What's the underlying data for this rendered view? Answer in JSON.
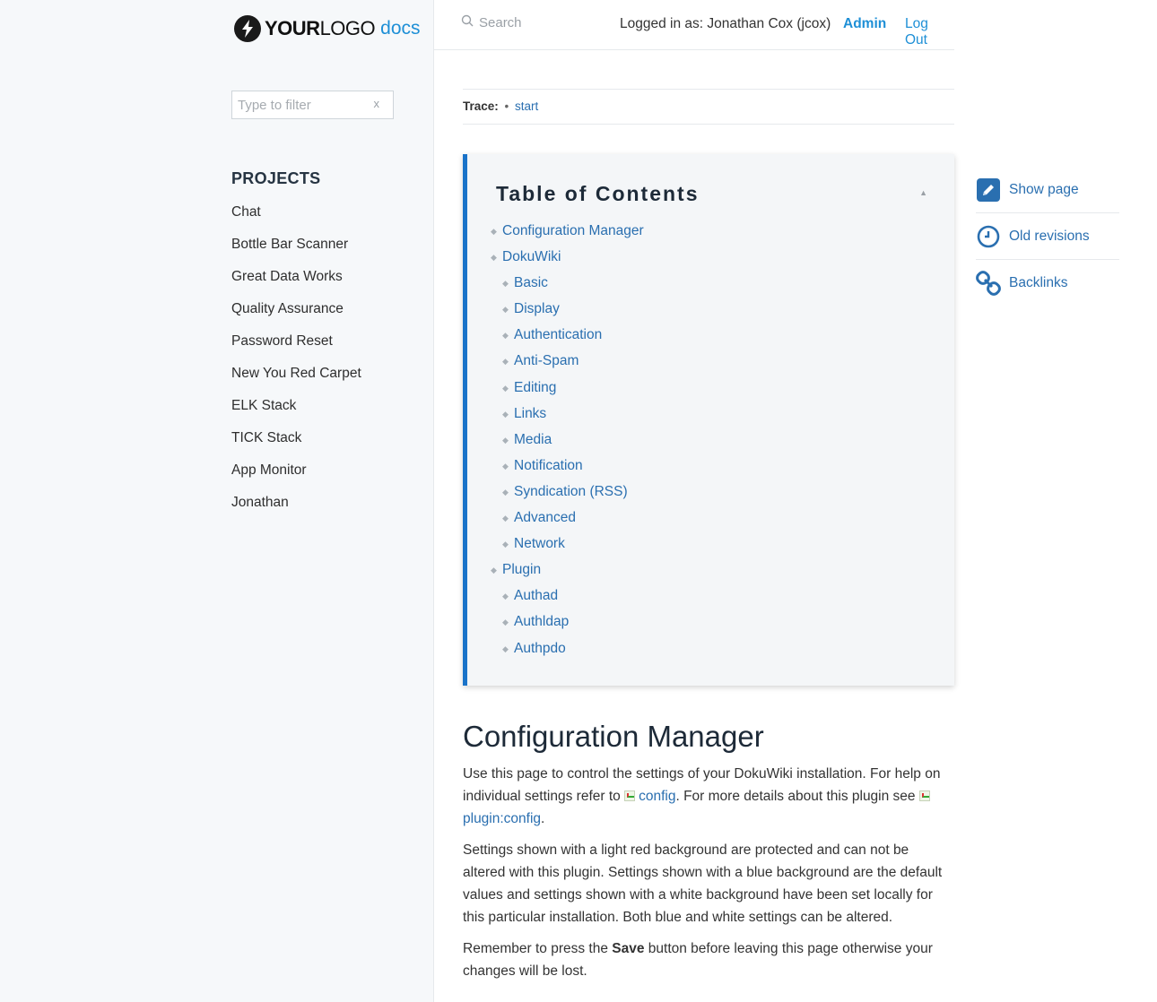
{
  "brand": {
    "logo_bold": "YOUR",
    "logo_light": "LOGO",
    "suffix": "docs"
  },
  "sidebar": {
    "filter_placeholder": "Type to filter",
    "filter_clear": "x",
    "projects_heading": "PROJECTS",
    "projects": [
      "Chat",
      "Bottle Bar Scanner",
      "Great Data Works",
      "Quality Assurance",
      "Password Reset",
      "New You Red Carpet",
      "ELK Stack",
      "TICK Stack",
      "App Monitor",
      "Jonathan"
    ]
  },
  "header": {
    "search_placeholder": "Search",
    "user_info": "Logged in as: Jonathan Cox (jcox)",
    "admin_label": "Admin",
    "logout_label": "Log Out"
  },
  "trace": {
    "label": "Trace:",
    "separator": "•",
    "crumb": "start"
  },
  "toc": {
    "title": "Table of Contents",
    "toggle": "▲",
    "items": [
      {
        "label": "Configuration Manager",
        "level": 1
      },
      {
        "label": "DokuWiki",
        "level": 1
      },
      {
        "label": "Basic",
        "level": 2
      },
      {
        "label": "Display",
        "level": 2
      },
      {
        "label": "Authentication",
        "level": 2
      },
      {
        "label": "Anti-Spam",
        "level": 2
      },
      {
        "label": "Editing",
        "level": 2
      },
      {
        "label": "Links",
        "level": 2
      },
      {
        "label": "Media",
        "level": 2
      },
      {
        "label": "Notification",
        "level": 2
      },
      {
        "label": "Syndication (RSS)",
        "level": 2
      },
      {
        "label": "Advanced",
        "level": 2
      },
      {
        "label": "Network",
        "level": 2
      },
      {
        "label": "Plugin",
        "level": 1
      },
      {
        "label": "Authad",
        "level": 2
      },
      {
        "label": "Authldap",
        "level": 2
      },
      {
        "label": "Authpdo",
        "level": 2
      }
    ]
  },
  "content": {
    "heading": "Configuration Manager",
    "p1_text1": "Use this page to control the settings of your DokuWiki installation. For help on individual settings refer to ",
    "p1_link1": "config",
    "p1_text2": ". For more details about this plugin see ",
    "p1_link2": "plugin:config",
    "p1_text3": ".",
    "p2": "Settings shown with a light red background are protected and can not be altered with this plugin. Settings shown with a blue background are the default values and settings shown with a white background have been set locally for this particular installation. Both blue and white settings can be altered.",
    "p3_text1": "Remember to press the ",
    "p3_bold": "Save",
    "p3_text2": " button before leaving this page otherwise your changes will be lost."
  },
  "page_tools": [
    {
      "label": "Show page",
      "icon": "pencil-icon"
    },
    {
      "label": "Old revisions",
      "icon": "clock-icon"
    },
    {
      "label": "Backlinks",
      "icon": "link-icon"
    }
  ],
  "colors": {
    "accent": "#1e8fd6",
    "link": "#2a6fb0",
    "toc_border": "#1a73c9"
  }
}
